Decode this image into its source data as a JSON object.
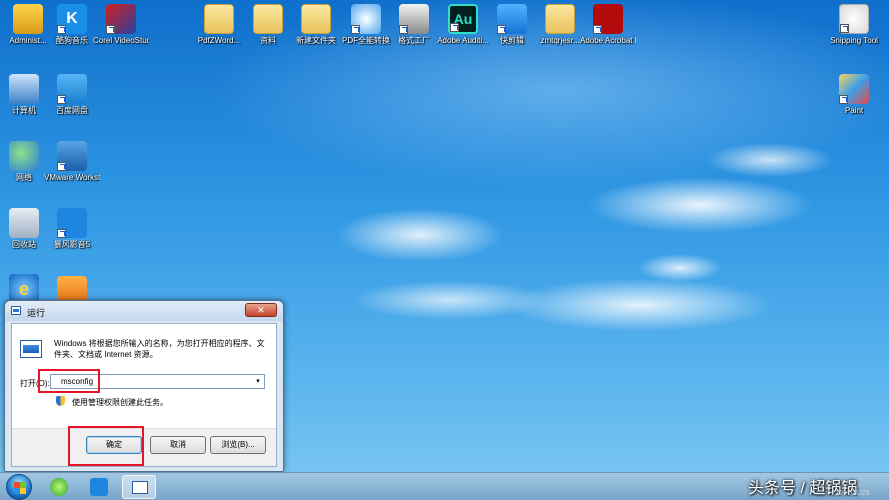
{
  "desktop": {
    "icons": [
      {
        "label": "Administ..."
      },
      {
        "label": "酷狗音乐",
        "glyph": "K"
      },
      {
        "label": "Corel VideoStud..."
      },
      {
        "label": "PdfZWord..."
      },
      {
        "label": "资料"
      },
      {
        "label": "新建文件夹"
      },
      {
        "label": "PDF全能转换"
      },
      {
        "label": "格式工厂"
      },
      {
        "label": "Adobe Auditi...",
        "glyph": "Au"
      },
      {
        "label": "快剪辑"
      },
      {
        "label": "zmtqrjesr..."
      },
      {
        "label": "Adobe Acrobat DC"
      },
      {
        "label": "Snipping Tool"
      },
      {
        "label": "计算机"
      },
      {
        "label": "百度网盘"
      },
      {
        "label": "Paint"
      },
      {
        "label": "网络"
      },
      {
        "label": "VMware Workstation"
      },
      {
        "label": "回收站"
      },
      {
        "label": "暴风影音5"
      },
      {
        "label": "",
        "glyph": "e"
      },
      {
        "label": ""
      }
    ]
  },
  "run_dialog": {
    "title": "运行",
    "close_glyph": "✕",
    "description": "Windows 将根据您所输入的名称，为您打开相应的程序、文件夹、文档或 Internet 资源。",
    "open_label": "打开(O):",
    "input_value": "msconfig",
    "dropdown_glyph": "▾",
    "admin_note": "使用管理权限创建此任务。",
    "ok_label": "确定",
    "cancel_label": "取消",
    "browse_label": "浏览(B)..."
  },
  "taskbar": {
    "watermark": "头条号 / 超锅锅",
    "date_fragment": "2017/11/25"
  },
  "colors": {
    "highlight_box": "#e3162a",
    "dialog_bg": "#dbe6f3",
    "taskbar": "#8fb3d3"
  }
}
